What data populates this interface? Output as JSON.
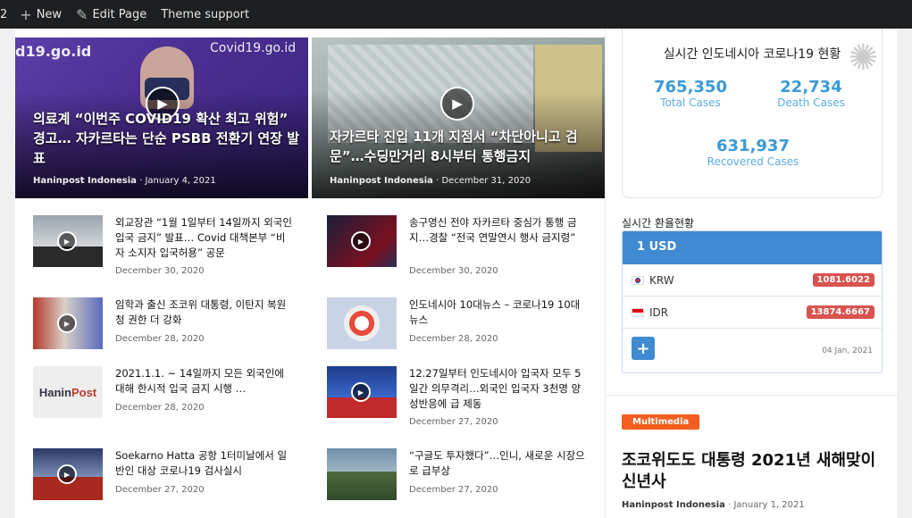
{
  "adminbar": {
    "cut_label": "2",
    "new_label": "New",
    "edit_label": "Edit Page",
    "theme_label": "Theme support"
  },
  "heroes": [
    {
      "logo": "d19.go.id",
      "logo2": "Covid19.go.id",
      "title": "의료계 “이번주 COVID19 확산 최고 위험” 경고… 자카르타는 단순 PSBB 전환기 연장 발표",
      "author": "Haninpost Indonesia",
      "date": "January 4, 2021"
    },
    {
      "title": "자카르타 진입 11개 지점서 “차단아니고 검문”…수딩만거리 8시부터 통행금지",
      "author": "Haninpost Indonesia",
      "date": "December 31, 2020"
    }
  ],
  "posts": [
    {
      "title": "외교장관 “1월 1일부터 14일까지 외국인 입국 금지” 발표… Covid 대책본부 “비자 소지자 입국허용” 공문",
      "date": "December 30, 2020"
    },
    {
      "title": "송구영신 전야 자카르타 중심가 통행 금지…경찰 “전국 연말연시 행사 금지령”",
      "date": "December 30, 2020"
    },
    {
      "title": "임학과 출신 조코위 대통령, 이탄지 복원청 권한 더 강화",
      "date": "December 28, 2020"
    },
    {
      "title": "인도네시아 10대뉴스 – 코로나19 10대뉴스",
      "date": "December 28, 2020"
    },
    {
      "title": "2021.1.1. ~ 14일까지 모든 외국인에 대해 한시적 입국 금지 시행 …",
      "date": "December 28, 2020"
    },
    {
      "title": "12.27일부터 인도네시아 입국자 모두 5일간 의무격리…외국인 입국자 3천명 양성반응에 급 제동",
      "date": "December 27, 2020"
    },
    {
      "title": "Soekarno Hatta 공항 1터미날에서 일반인 대상 코로나19 검사실시",
      "date": "December 27, 2020"
    },
    {
      "title": "“구글도 투자했다”…인니, 새로운 시장으로 급부상",
      "date": "December 27, 2020"
    }
  ],
  "hanin_logo": {
    "a": "Hanin",
    "b": "Post"
  },
  "covid": {
    "title": "실시간 인도네시아 코로나19 현황",
    "total": "765,350",
    "total_label": "Total Cases",
    "death": "22,734",
    "death_label": "Death Cases",
    "recovered": "631,937",
    "recovered_label": "Recovered Cases"
  },
  "fx": {
    "title": "실시간 환율현황",
    "base": "1 USD",
    "rows": [
      {
        "code": "KRW",
        "value": "1081.6022"
      },
      {
        "code": "IDR",
        "value": "13874.6667"
      }
    ],
    "add_label": "+",
    "date": "04 Jan, 2021"
  },
  "side_post": {
    "badge": "Multimedia",
    "title": "조코위도도 대통령 2021년 새해맞이 신년사",
    "author": "Haninpost Indonesia",
    "date": "January 1, 2021"
  },
  "icons": {
    "plus": "+",
    "pencil": "✎",
    "play": "▶",
    "virus": "✺"
  },
  "colors": {
    "accent": "#3f8ad0",
    "badge": "#f45d1f",
    "stat": "#3a9ad9",
    "fxval": "#d9534f"
  }
}
